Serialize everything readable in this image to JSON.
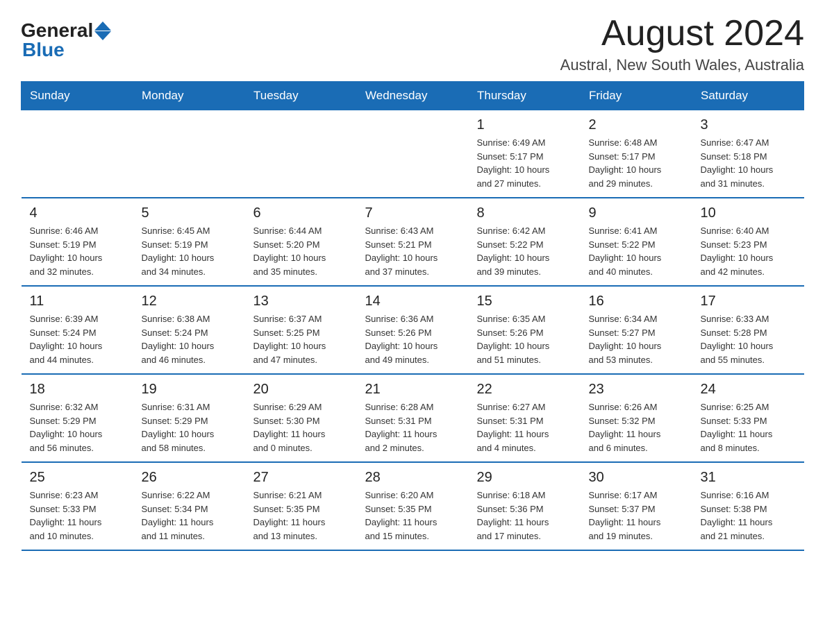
{
  "header": {
    "logo_general": "General",
    "logo_blue": "Blue",
    "title": "August 2024",
    "subtitle": "Austral, New South Wales, Australia"
  },
  "days_of_week": [
    "Sunday",
    "Monday",
    "Tuesday",
    "Wednesday",
    "Thursday",
    "Friday",
    "Saturday"
  ],
  "weeks": [
    [
      {
        "day": "",
        "info": ""
      },
      {
        "day": "",
        "info": ""
      },
      {
        "day": "",
        "info": ""
      },
      {
        "day": "",
        "info": ""
      },
      {
        "day": "1",
        "info": "Sunrise: 6:49 AM\nSunset: 5:17 PM\nDaylight: 10 hours\nand 27 minutes."
      },
      {
        "day": "2",
        "info": "Sunrise: 6:48 AM\nSunset: 5:17 PM\nDaylight: 10 hours\nand 29 minutes."
      },
      {
        "day": "3",
        "info": "Sunrise: 6:47 AM\nSunset: 5:18 PM\nDaylight: 10 hours\nand 31 minutes."
      }
    ],
    [
      {
        "day": "4",
        "info": "Sunrise: 6:46 AM\nSunset: 5:19 PM\nDaylight: 10 hours\nand 32 minutes."
      },
      {
        "day": "5",
        "info": "Sunrise: 6:45 AM\nSunset: 5:19 PM\nDaylight: 10 hours\nand 34 minutes."
      },
      {
        "day": "6",
        "info": "Sunrise: 6:44 AM\nSunset: 5:20 PM\nDaylight: 10 hours\nand 35 minutes."
      },
      {
        "day": "7",
        "info": "Sunrise: 6:43 AM\nSunset: 5:21 PM\nDaylight: 10 hours\nand 37 minutes."
      },
      {
        "day": "8",
        "info": "Sunrise: 6:42 AM\nSunset: 5:22 PM\nDaylight: 10 hours\nand 39 minutes."
      },
      {
        "day": "9",
        "info": "Sunrise: 6:41 AM\nSunset: 5:22 PM\nDaylight: 10 hours\nand 40 minutes."
      },
      {
        "day": "10",
        "info": "Sunrise: 6:40 AM\nSunset: 5:23 PM\nDaylight: 10 hours\nand 42 minutes."
      }
    ],
    [
      {
        "day": "11",
        "info": "Sunrise: 6:39 AM\nSunset: 5:24 PM\nDaylight: 10 hours\nand 44 minutes."
      },
      {
        "day": "12",
        "info": "Sunrise: 6:38 AM\nSunset: 5:24 PM\nDaylight: 10 hours\nand 46 minutes."
      },
      {
        "day": "13",
        "info": "Sunrise: 6:37 AM\nSunset: 5:25 PM\nDaylight: 10 hours\nand 47 minutes."
      },
      {
        "day": "14",
        "info": "Sunrise: 6:36 AM\nSunset: 5:26 PM\nDaylight: 10 hours\nand 49 minutes."
      },
      {
        "day": "15",
        "info": "Sunrise: 6:35 AM\nSunset: 5:26 PM\nDaylight: 10 hours\nand 51 minutes."
      },
      {
        "day": "16",
        "info": "Sunrise: 6:34 AM\nSunset: 5:27 PM\nDaylight: 10 hours\nand 53 minutes."
      },
      {
        "day": "17",
        "info": "Sunrise: 6:33 AM\nSunset: 5:28 PM\nDaylight: 10 hours\nand 55 minutes."
      }
    ],
    [
      {
        "day": "18",
        "info": "Sunrise: 6:32 AM\nSunset: 5:29 PM\nDaylight: 10 hours\nand 56 minutes."
      },
      {
        "day": "19",
        "info": "Sunrise: 6:31 AM\nSunset: 5:29 PM\nDaylight: 10 hours\nand 58 minutes."
      },
      {
        "day": "20",
        "info": "Sunrise: 6:29 AM\nSunset: 5:30 PM\nDaylight: 11 hours\nand 0 minutes."
      },
      {
        "day": "21",
        "info": "Sunrise: 6:28 AM\nSunset: 5:31 PM\nDaylight: 11 hours\nand 2 minutes."
      },
      {
        "day": "22",
        "info": "Sunrise: 6:27 AM\nSunset: 5:31 PM\nDaylight: 11 hours\nand 4 minutes."
      },
      {
        "day": "23",
        "info": "Sunrise: 6:26 AM\nSunset: 5:32 PM\nDaylight: 11 hours\nand 6 minutes."
      },
      {
        "day": "24",
        "info": "Sunrise: 6:25 AM\nSunset: 5:33 PM\nDaylight: 11 hours\nand 8 minutes."
      }
    ],
    [
      {
        "day": "25",
        "info": "Sunrise: 6:23 AM\nSunset: 5:33 PM\nDaylight: 11 hours\nand 10 minutes."
      },
      {
        "day": "26",
        "info": "Sunrise: 6:22 AM\nSunset: 5:34 PM\nDaylight: 11 hours\nand 11 minutes."
      },
      {
        "day": "27",
        "info": "Sunrise: 6:21 AM\nSunset: 5:35 PM\nDaylight: 11 hours\nand 13 minutes."
      },
      {
        "day": "28",
        "info": "Sunrise: 6:20 AM\nSunset: 5:35 PM\nDaylight: 11 hours\nand 15 minutes."
      },
      {
        "day": "29",
        "info": "Sunrise: 6:18 AM\nSunset: 5:36 PM\nDaylight: 11 hours\nand 17 minutes."
      },
      {
        "day": "30",
        "info": "Sunrise: 6:17 AM\nSunset: 5:37 PM\nDaylight: 11 hours\nand 19 minutes."
      },
      {
        "day": "31",
        "info": "Sunrise: 6:16 AM\nSunset: 5:38 PM\nDaylight: 11 hours\nand 21 minutes."
      }
    ]
  ]
}
